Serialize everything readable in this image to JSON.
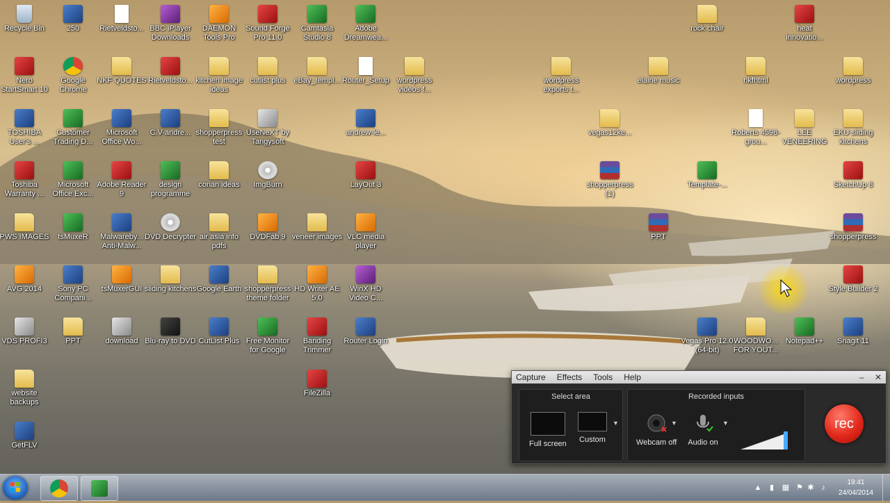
{
  "desktop": {
    "icons": [
      {
        "label": "Recycle Bin",
        "type": "bin"
      },
      {
        "label": "250",
        "type": "app"
      },
      {
        "label": "Rietveldsto...",
        "type": "file"
      },
      {
        "label": "BBC iPlayer Downloads",
        "type": "purple"
      },
      {
        "label": "DAEMON Tools Pro",
        "type": "orange"
      },
      {
        "label": "Sound Forge Pro 11.0",
        "type": "red"
      },
      {
        "label": "Camtasia Studio 8",
        "type": "green"
      },
      {
        "label": "Adobe Dreamwea...",
        "type": "green"
      },
      {
        "label": "rock chair",
        "type": "folder"
      },
      {
        "label": "heat innovatio...",
        "type": "red"
      },
      {
        "label": "Nero StartSmart 10",
        "type": "red"
      },
      {
        "label": "Google Chrome",
        "type": "chrome"
      },
      {
        "label": "NKF QUOTES",
        "type": "folder"
      },
      {
        "label": "Rietveldsto...",
        "type": "red"
      },
      {
        "label": "kitchen image ideas",
        "type": "folder"
      },
      {
        "label": "cutlist plus",
        "type": "folder"
      },
      {
        "label": "eBay_templ...",
        "type": "folder"
      },
      {
        "label": "Router_Setup",
        "type": "file"
      },
      {
        "label": "wordpress videos f...",
        "type": "folder"
      },
      {
        "label": "wordpress exports t...",
        "type": "folder"
      },
      {
        "label": "elaine music",
        "type": "folder"
      },
      {
        "label": "nkfhtml",
        "type": "folder"
      },
      {
        "label": "wordpress",
        "type": "folder"
      },
      {
        "label": "TOSHIBA User's ...",
        "type": "app"
      },
      {
        "label": "Customer Trading D...",
        "type": "green"
      },
      {
        "label": "Microsoft Office Wo...",
        "type": "app"
      },
      {
        "label": "C.V-andre...",
        "type": "app"
      },
      {
        "label": "shopperpress test",
        "type": "folder"
      },
      {
        "label": "UseNeXT by Tangysoft",
        "type": "gray"
      },
      {
        "label": "andrew-le...",
        "type": "app"
      },
      {
        "label": "vegas12ke...",
        "type": "folder"
      },
      {
        "label": "Roberts 4598-grou...",
        "type": "file"
      },
      {
        "label": "LEE VENEERING",
        "type": "folder"
      },
      {
        "label": "EKU sliding kitchens",
        "type": "folder"
      },
      {
        "label": "Toshiba Warranty ...",
        "type": "red"
      },
      {
        "label": "Microsoft Office Exc...",
        "type": "green"
      },
      {
        "label": "Adobe Reader 9",
        "type": "red"
      },
      {
        "label": "design programme",
        "type": "green"
      },
      {
        "label": "corian ideas",
        "type": "folder"
      },
      {
        "label": "ImgBurn",
        "type": "disc"
      },
      {
        "label": "LayOut 3",
        "type": "red"
      },
      {
        "label": "shopperpress (1)",
        "type": "rar"
      },
      {
        "label": "Template-...",
        "type": "green"
      },
      {
        "label": "SketchUp 8",
        "type": "red"
      },
      {
        "label": "PWS IMAGES",
        "type": "folder"
      },
      {
        "label": "tsMuxeR",
        "type": "green"
      },
      {
        "label": "Malwareby... Anti-Malw...",
        "type": "app"
      },
      {
        "label": "DVD Decrypter",
        "type": "disc"
      },
      {
        "label": "air asia info pdfs",
        "type": "folder"
      },
      {
        "label": "DVDFab 9",
        "type": "orange"
      },
      {
        "label": "veneer images",
        "type": "folder"
      },
      {
        "label": "VLC media player",
        "type": "orange"
      },
      {
        "label": "PPT",
        "type": "rar"
      },
      {
        "label": "shopperpress",
        "type": "rar"
      },
      {
        "label": "AVG 2014",
        "type": "orange"
      },
      {
        "label": "Sony PC Compani...",
        "type": "app"
      },
      {
        "label": "tsMuxerGUI",
        "type": "orange"
      },
      {
        "label": "sliding kitchens",
        "type": "folder"
      },
      {
        "label": "Google Earth",
        "type": "app"
      },
      {
        "label": "shopperpress theme folder",
        "type": "folder"
      },
      {
        "label": "HD Writer AE 5.0",
        "type": "orange"
      },
      {
        "label": "WinX HD Video C...",
        "type": "purple"
      },
      {
        "label": "Style Builder 2",
        "type": "red"
      },
      {
        "label": "VDS PROFI3",
        "type": "gray"
      },
      {
        "label": "PPT",
        "type": "folder"
      },
      {
        "label": "download",
        "type": "gray"
      },
      {
        "label": "Blu-ray to DVD",
        "type": "dark"
      },
      {
        "label": "CutList Plus",
        "type": "app"
      },
      {
        "label": "Free Monitor for Google",
        "type": "green"
      },
      {
        "label": "Banding Trimmer",
        "type": "red"
      },
      {
        "label": "Router Login",
        "type": "app"
      },
      {
        "label": "Vegas Pro 12.0 (64-bit)",
        "type": "app"
      },
      {
        "label": "WOODWO... FOR YOUT...",
        "type": "folder"
      },
      {
        "label": "Notepad++",
        "type": "green"
      },
      {
        "label": "Snagit 11",
        "type": "app"
      },
      {
        "label": "website backups",
        "type": "folder"
      },
      {
        "label": "FileZilla",
        "type": "red"
      },
      {
        "label": "GetFLV",
        "type": "app"
      }
    ]
  },
  "recorder": {
    "menu": [
      "Capture",
      "Effects",
      "Tools",
      "Help"
    ],
    "minimize": "–",
    "close": "✕",
    "select_area_title": "Select area",
    "full_screen": "Full screen",
    "custom": "Custom",
    "recorded_inputs_title": "Recorded inputs",
    "webcam": "Webcam off",
    "audio": "Audio on",
    "rec": "rec"
  },
  "taskbar": {
    "time": "19:41",
    "date": "24/04/2014"
  }
}
